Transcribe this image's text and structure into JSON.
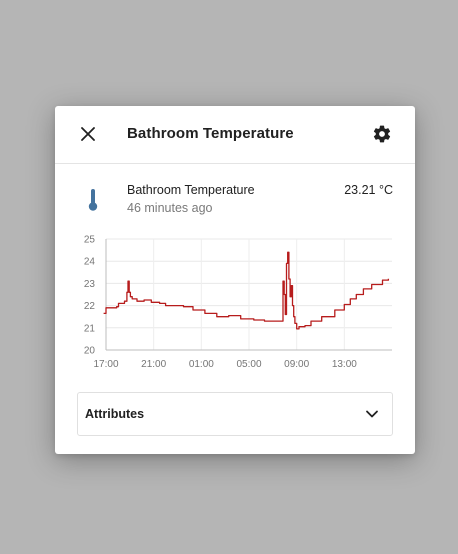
{
  "dialog": {
    "title": "Bathroom Temperature"
  },
  "entity": {
    "name": "Bathroom Temperature",
    "last_changed": "46 minutes ago",
    "state": "23.21 °C",
    "icon": "thermometer-icon"
  },
  "colors": {
    "line": "#b71c1c",
    "icon": "#44739e"
  },
  "chart_data": {
    "type": "line",
    "ylim": [
      20,
      25
    ],
    "y_ticks": [
      "20",
      "21",
      "22",
      "23",
      "24",
      "25"
    ],
    "x_range": [
      0,
      24
    ],
    "x_ticks": [
      {
        "label": "17:00",
        "x": 0
      },
      {
        "label": "21:00",
        "x": 4
      },
      {
        "label": "01:00",
        "x": 8
      },
      {
        "label": "05:00",
        "x": 12
      },
      {
        "label": "09:00",
        "x": 16
      },
      {
        "label": "13:00",
        "x": 20
      }
    ],
    "series": [
      {
        "values": [
          [
            -0.2,
            21.65
          ],
          [
            0.0,
            21.9
          ],
          [
            0.9,
            21.95
          ],
          [
            1.05,
            22.1
          ],
          [
            1.55,
            22.2
          ],
          [
            1.75,
            22.6
          ],
          [
            1.85,
            23.1
          ],
          [
            1.95,
            22.6
          ],
          [
            2.05,
            22.4
          ],
          [
            2.2,
            22.3
          ],
          [
            2.6,
            22.2
          ],
          [
            3.2,
            22.25
          ],
          [
            3.8,
            22.15
          ],
          [
            4.5,
            22.1
          ],
          [
            5.0,
            22.0
          ],
          [
            6.5,
            21.95
          ],
          [
            7.3,
            21.8
          ],
          [
            8.3,
            21.65
          ],
          [
            9.3,
            21.5
          ],
          [
            10.3,
            21.55
          ],
          [
            11.3,
            21.4
          ],
          [
            12.4,
            21.35
          ],
          [
            13.3,
            21.3
          ],
          [
            14.7,
            21.3
          ],
          [
            14.85,
            23.1
          ],
          [
            14.95,
            22.5
          ],
          [
            15.05,
            21.6
          ],
          [
            15.15,
            23.9
          ],
          [
            15.25,
            24.4
          ],
          [
            15.35,
            23.2
          ],
          [
            15.45,
            22.4
          ],
          [
            15.55,
            22.9
          ],
          [
            15.65,
            22.0
          ],
          [
            15.75,
            21.5
          ],
          [
            15.85,
            21.2
          ],
          [
            16.0,
            20.95
          ],
          [
            16.2,
            21.05
          ],
          [
            16.7,
            21.1
          ],
          [
            17.2,
            21.3
          ],
          [
            18.1,
            21.5
          ],
          [
            19.2,
            21.8
          ],
          [
            20.0,
            22.05
          ],
          [
            20.5,
            22.3
          ],
          [
            21.0,
            22.5
          ],
          [
            21.6,
            22.75
          ],
          [
            22.3,
            22.95
          ],
          [
            23.2,
            23.15
          ],
          [
            23.7,
            23.21
          ]
        ]
      }
    ]
  }
}
